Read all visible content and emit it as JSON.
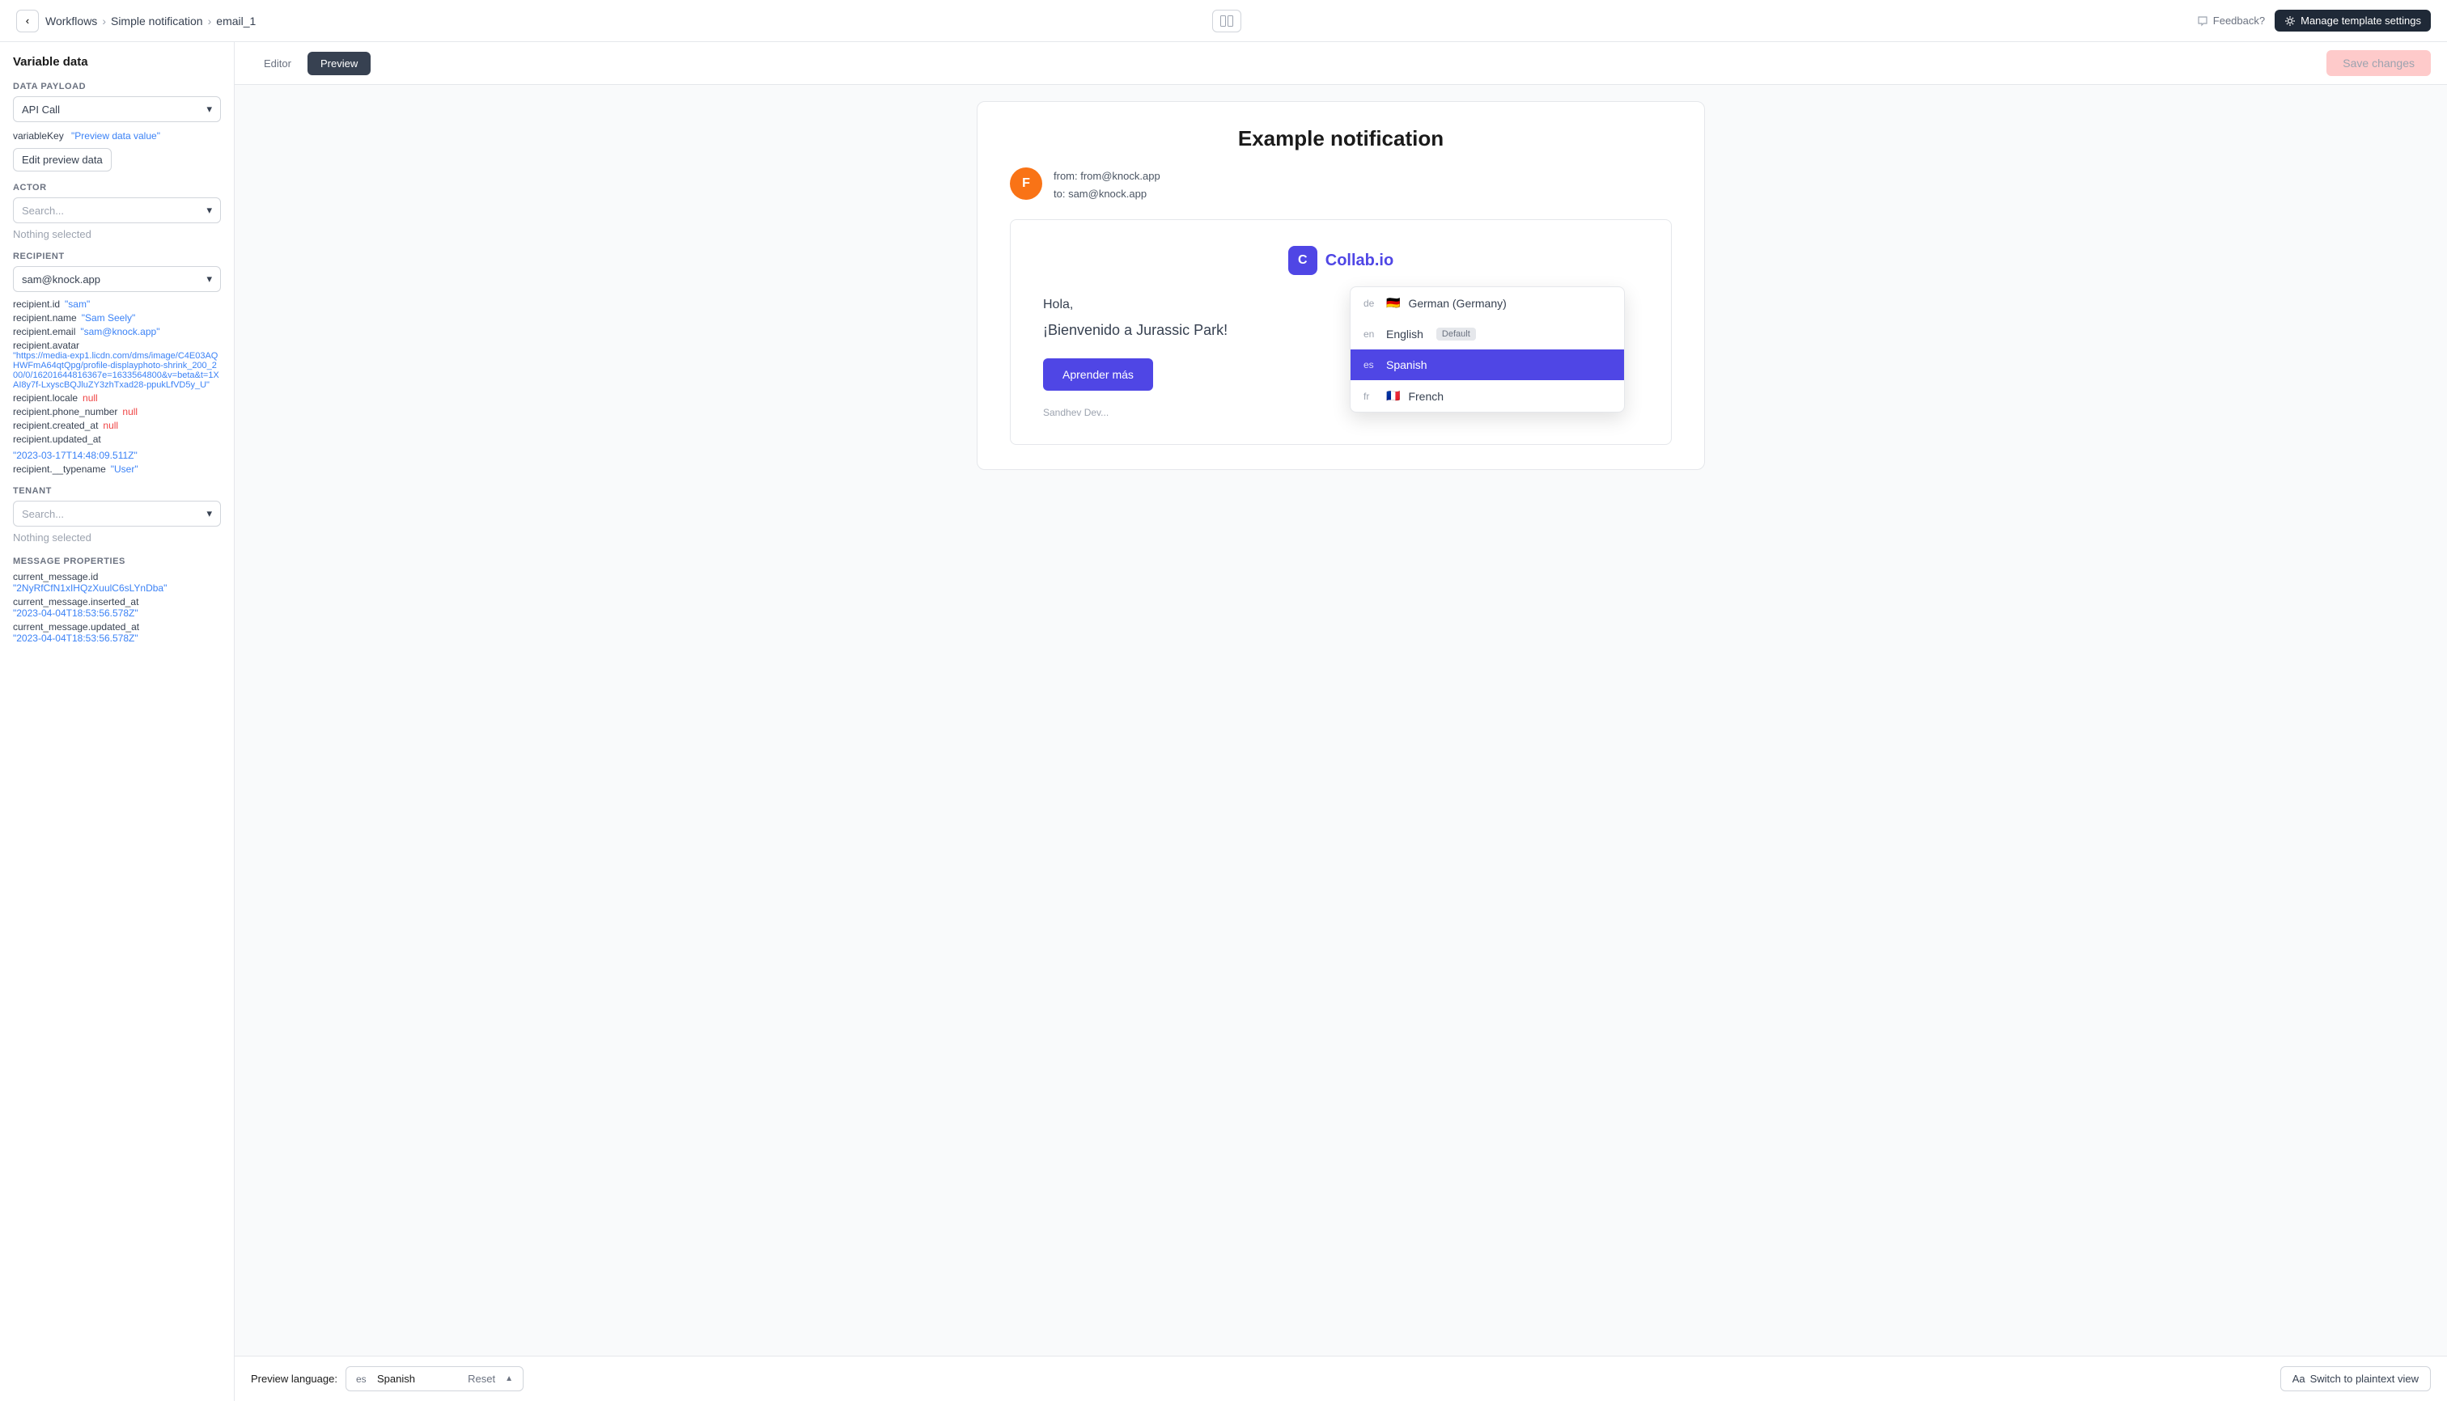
{
  "topnav": {
    "breadcrumb": [
      "Workflows",
      "Simple notification",
      "email_1"
    ],
    "feedback_label": "Feedback?",
    "manage_label": "Manage template settings",
    "layout_icon": "layout-icon"
  },
  "sidebar": {
    "title": "Variable data",
    "data_payload_label": "DATA PAYLOAD",
    "data_payload_value": "API Call",
    "variable_key_label": "variableKey",
    "variable_key_value": "\"Preview data value\"",
    "edit_preview_btn": "Edit preview data",
    "actor_label": "ACTOR",
    "actor_placeholder": "Search...",
    "actor_nothing": "Nothing selected",
    "recipient_label": "RECIPIENT",
    "recipient_value": "sam@knock.app",
    "recipient_id_key": "recipient.id",
    "recipient_id_val": "\"sam\"",
    "recipient_name_key": "recipient.name",
    "recipient_name_val": "\"Sam Seely\"",
    "recipient_email_key": "recipient.email",
    "recipient_email_val": "\"sam@knock.app\"",
    "recipient_avatar_key": "recipient.avatar",
    "recipient_avatar_val": "\"https://media-exp1.licdn.com/dms/image/C4E03AQHWFmA64qtQpg/profile-displayphoto-shrink_200_200/0/16201644816367e=1633564800&v=beta&t=1XAI8y7f-LxyscBQJluZY3zhTxad28-ppukLfVD5y_U\"",
    "recipient_locale_key": "recipient.locale",
    "recipient_locale_val": "null",
    "recipient_phone_key": "recipient.phone_number",
    "recipient_phone_val": "null",
    "recipient_created_key": "recipient.created_at",
    "recipient_created_val": "null",
    "recipient_updated_key": "recipient.updated_at",
    "recipient_updated_val": "\"2023-03-17T14:48:09.511Z\"",
    "recipient_typename_key": "recipient.__typename",
    "recipient_typename_val": "\"User\"",
    "tenant_label": "TENANT",
    "tenant_placeholder": "Search...",
    "tenant_nothing": "Nothing selected",
    "message_props_label": "MESSAGE PROPERTIES",
    "current_message_id_key": "current_message.id",
    "current_message_id_val": "\"2NyRfCfN1xIHQzXuulC6sLYnDba\"",
    "current_message_inserted_key": "current_message.inserted_at",
    "current_message_inserted_val": "\"2023-04-04T18:53:56.578Z\"",
    "current_message_updated_key": "current_message.updated_at",
    "current_message_updated_val": "\"2023-04-04T18:53:56.578Z\""
  },
  "tabs": {
    "editor": "Editor",
    "preview": "Preview",
    "active": "Preview"
  },
  "toolbar": {
    "save_label": "Save changes"
  },
  "preview": {
    "notification_title": "Example notification",
    "from": "from: from@knock.app",
    "to": "to: sam@knock.app",
    "avatar_letter": "F",
    "collab_name": "Collab.io",
    "collab_letter": "C",
    "greeting": "Hola,",
    "body": "¡Bienvenido a Jurassic Park!",
    "cta": "Aprender más",
    "footer": "Sandhev Dev..."
  },
  "language_dropdown": {
    "items": [
      {
        "code": "de",
        "flag": "🇩🇪",
        "name": "German (Germany)",
        "selected": false
      },
      {
        "code": "en",
        "flag": "",
        "name": "English",
        "default": true,
        "selected": false
      },
      {
        "code": "es",
        "flag": "",
        "name": "Spanish",
        "selected": true
      },
      {
        "code": "fr",
        "flag": "🇫🇷",
        "name": "French",
        "selected": false
      }
    ]
  },
  "language_bar": {
    "label": "Preview language:",
    "selected_code": "es",
    "selected_name": "Spanish",
    "reset_label": "Reset",
    "switch_label": "Switch to plaintext view",
    "switch_prefix": "Aa"
  }
}
